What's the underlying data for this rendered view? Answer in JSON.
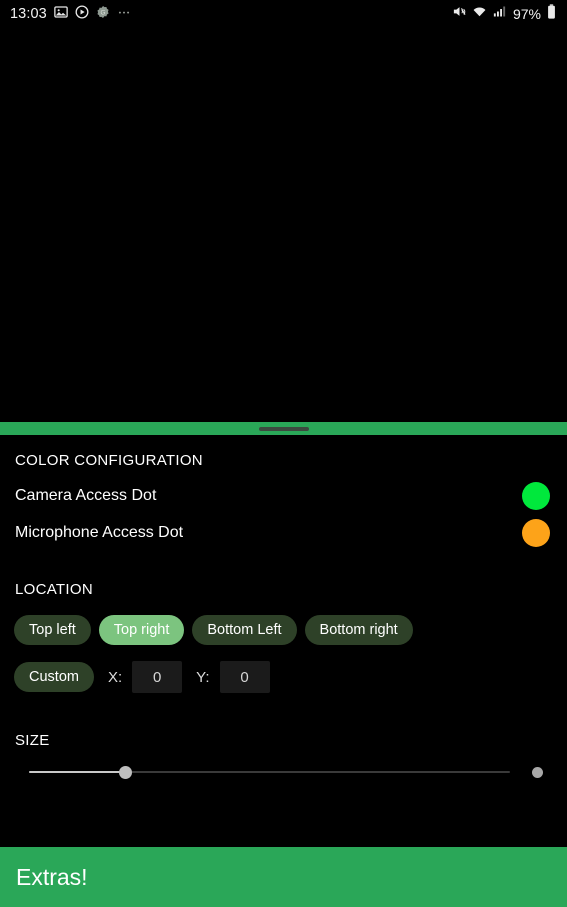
{
  "status_bar": {
    "clock": "13:03",
    "battery_percent": "97%",
    "left_icons": [
      "image-icon",
      "record-circle-icon",
      "google-assistant-icon",
      "more-ellipsis-icon"
    ],
    "right_icons": [
      "mute-vibrate-icon",
      "wifi-icon",
      "cellular-signal-icon",
      "battery-icon"
    ]
  },
  "sheet": {
    "handle": "drag-handle",
    "accent_green": "#2aa758"
  },
  "color_configuration": {
    "header": "COLOR CONFIGURATION",
    "rows": [
      {
        "label": "Camera Access Dot",
        "color": "#00e83c"
      },
      {
        "label": "Microphone Access Dot",
        "color": "#fda319"
      }
    ]
  },
  "location": {
    "header": "LOCATION",
    "chips": [
      {
        "label": "Top left",
        "selected": false
      },
      {
        "label": "Top right",
        "selected": true
      },
      {
        "label": "Bottom Left",
        "selected": false
      },
      {
        "label": "Bottom right",
        "selected": false
      }
    ],
    "custom": {
      "chip_label": "Custom",
      "selected": false,
      "x_label": "X:",
      "x_value": "0",
      "y_label": "Y:",
      "y_value": "0"
    }
  },
  "size": {
    "header": "SIZE",
    "slider_percent": 20,
    "preview_dot": "size-preview-dot"
  },
  "extras": {
    "label": "Extras!"
  }
}
